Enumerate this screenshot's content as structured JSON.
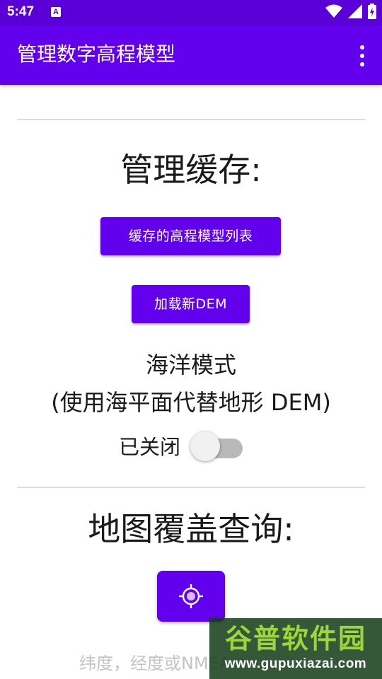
{
  "status_bar": {
    "time": "5:47",
    "notification_glyph": "A",
    "icons": [
      "wifi-icon",
      "signal-icon",
      "battery-icon"
    ]
  },
  "app_bar": {
    "title": "管理数字高程模型",
    "menu_icon": "overflow-menu-icon"
  },
  "cache_section": {
    "heading": "管理缓存:",
    "list_button": "缓存的高程模型列表",
    "load_button": "加载新DEM"
  },
  "ocean_mode": {
    "title": "海洋模式",
    "subtitle": "(使用海平面代替地形 DEM)",
    "switch_label": "已关闭",
    "switch_on": false
  },
  "coverage_section": {
    "heading": "地图覆盖查询:",
    "locate_icon": "my-location-icon",
    "coord_text": "纬度，经度或NMEA"
  },
  "watermark": {
    "main": "谷普软件园",
    "url": "www.gupuxiazai.com"
  },
  "colors": {
    "primary": "#6200ee",
    "status_bar": "#5a00d6",
    "switch_track": "#b9b9b9"
  }
}
